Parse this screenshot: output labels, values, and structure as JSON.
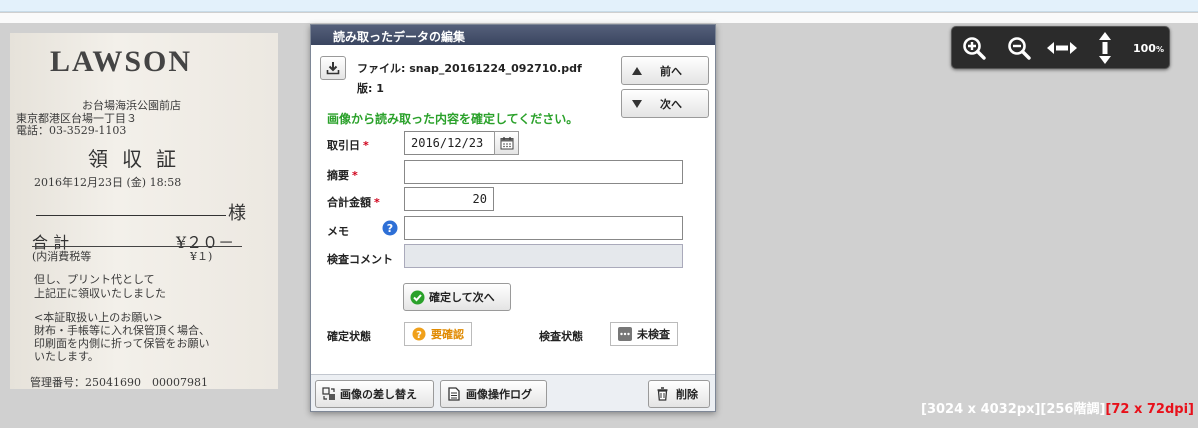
{
  "dialog": {
    "title": "読み取ったデータの編集",
    "file_label": "ファイル: snap_20161224_092710.pdf",
    "version_label": "版: 1",
    "prev_label": "前へ",
    "next_label": "次へ",
    "message": "画像から読み取った内容を確定してください。",
    "fields": {
      "date_label": "取引日",
      "date_value": "2016/12/23",
      "summary_label": "摘要",
      "summary_value": "",
      "amount_label": "合計金額",
      "amount_value": "20",
      "memo_label": "メモ",
      "memo_value": "",
      "review_comment_label": "検査コメント",
      "review_comment_value": "",
      "required_mark": "*"
    },
    "confirm_next_label": "確定して次へ",
    "status": {
      "confirm_label": "確定状態",
      "confirm_value": "要確認",
      "inspect_label": "検査状態",
      "inspect_value": "未検査"
    },
    "footer": {
      "replace_label": "画像の差し替え",
      "log_label": "画像操作ログ",
      "delete_label": "削除"
    }
  },
  "zoom": {
    "level": "100",
    "unit": "%"
  },
  "image_info": {
    "size": "[3024 x 4032px]",
    "levels": "[256階調]",
    "dpi": "[72 x 72dpi]"
  },
  "receipt": {
    "brand": "LAWSON",
    "store": "お台場海浜公園前店",
    "address": "東京都港区台場一丁目３",
    "phone": "電話：03-3529-1103",
    "title": "領収証",
    "datetime": "2016年12月23日 (金) 18:58",
    "sama": "様",
    "total_label": "合 計",
    "total_value": "¥２０－",
    "tax_label": "(内消費税等",
    "tax_value": "¥１)",
    "note1": "但し、プリント代として",
    "note2": "上記正に領収いたしました",
    "note3": "<本証取扱い上のお願い>",
    "note4": "財布・手帳等に入れ保管頂く場合、",
    "note5": "印刷面を内側に折って保管をお願い",
    "note6": "いたします。",
    "mgmt": "管理番号：25041690　00007981"
  },
  "colors": {
    "accent_green": "#2aa12a",
    "required_red": "#d0021b",
    "title_bar": "#3a4560",
    "warn_orange": "#f0a01a"
  }
}
